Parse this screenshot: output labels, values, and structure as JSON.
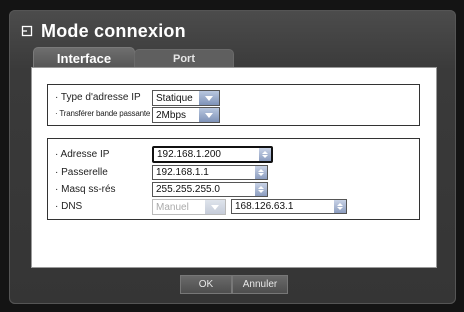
{
  "dialog": {
    "title": "Mode connexion",
    "title_icon": "network-icon"
  },
  "tabs": [
    {
      "label": "Interface",
      "active": true
    },
    {
      "label": "Port",
      "active": false
    }
  ],
  "group_type": {
    "ip_type_label": "· Type d'adresse IP",
    "ip_type_value": "Statique",
    "bandwidth_label": "· Transférer bande passante",
    "bandwidth_value": "2Mbps"
  },
  "group_network": {
    "ip_label": "· Adresse IP",
    "ip_value": "192.168.1.200",
    "gateway_label": "· Passerelle",
    "gateway_value": "192.168.1.1",
    "mask_label": "· Masq ss-rés",
    "mask_value": "255.255.255.0",
    "dns_label": "· DNS",
    "dns_mode_value": "Manuel",
    "dns_value": "168.126.63.1"
  },
  "buttons": {
    "ok": "OK",
    "cancel": "Annuler"
  }
}
